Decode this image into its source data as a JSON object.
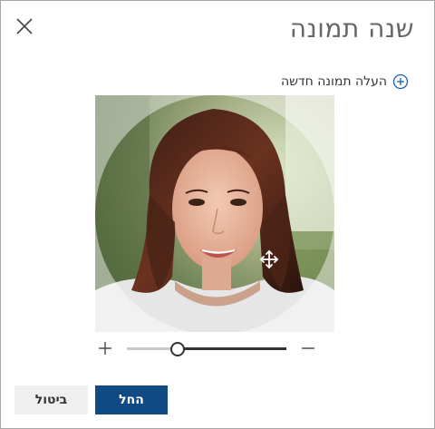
{
  "dialog": {
    "title": "שנה תמונה",
    "close_icon": "close-icon"
  },
  "upload": {
    "label": "העלה תמונה חדשה",
    "icon": "plus-circle-icon",
    "accent": "#1a5fb4"
  },
  "photo": {
    "move_icon": "move-icon"
  },
  "zoom": {
    "in_icon": "plus-icon",
    "out_icon": "minus-icon",
    "level": 0.32
  },
  "buttons": {
    "apply_label": "החל",
    "cancel_label": "ביטול",
    "apply_color": "#0f4a85",
    "cancel_color": "#efefef"
  }
}
